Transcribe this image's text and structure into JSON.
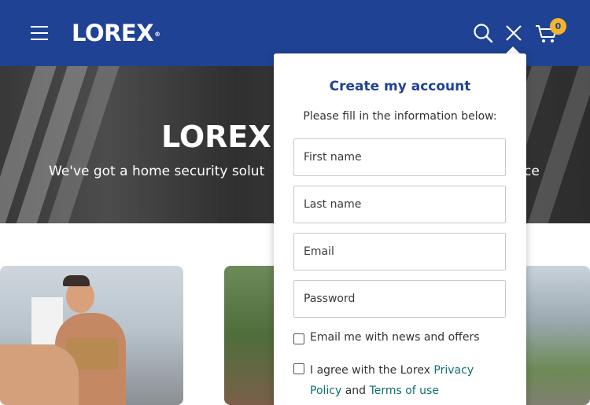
{
  "header": {
    "logo": "LOREX",
    "logo_mark": "®",
    "cart_count": "0",
    "icons": [
      "menu-icon",
      "search-icon",
      "close-icon",
      "cart-icon"
    ],
    "background": "#1f4294",
    "badge_color": "#f3b62b"
  },
  "hero": {
    "title": "LOREX I",
    "subtitle": "We've got a home security solut",
    "subtitle_tail": "ce"
  },
  "account_panel": {
    "title": "Create my account",
    "subtitle": "Please fill in the information below:",
    "fields": {
      "first_name_placeholder": "First name",
      "last_name_placeholder": "Last name",
      "email_placeholder": "Email",
      "password_placeholder": "Password"
    },
    "news_label": "Email me with news and offers",
    "agree_prefix": "I agree with the Lorex ",
    "privacy_link": "Privacy Policy",
    "and_text": " and ",
    "terms_link": "Terms of use",
    "title_color": "#1f4294",
    "link_color": "#0e6e6e"
  }
}
